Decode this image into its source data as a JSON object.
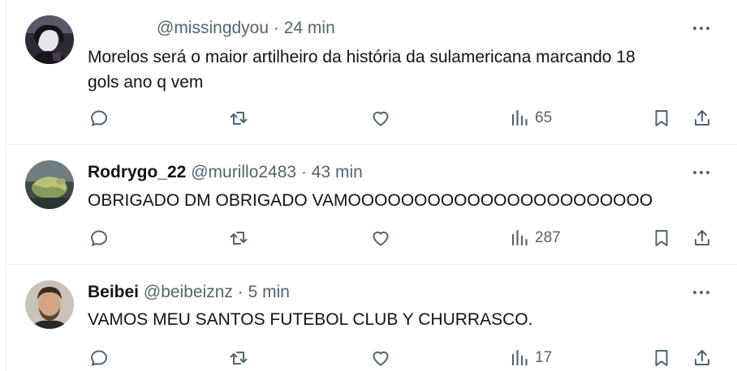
{
  "tweets": [
    {
      "name": "",
      "handle": "@missingdyou",
      "separator": "·",
      "time": "24 min",
      "text_lines": [
        "Morelos será o maior artilheiro da história da sulamericana marcando 18",
        "gols ano q vem"
      ],
      "views": "65"
    },
    {
      "name": "Rodrygo_22",
      "handle": "@murillo2483",
      "separator": "·",
      "time": "43 min",
      "text_lines": [
        "OBRIGADO DM OBRIGADO VAMOOOOOOOOOOOOOOOOOOOOOOO"
      ],
      "views": "287"
    },
    {
      "name": "Beibei",
      "handle": "@beibeiznz",
      "separator": "·",
      "time": "5 min",
      "text_lines": [
        "VAMOS MEU SANTOS FUTEBOL CLUB Y CHURRASCO."
      ],
      "views": "17"
    }
  ],
  "icons": {
    "reply": "reply-icon",
    "retweet": "retweet-icon",
    "like": "heart-icon",
    "views": "views-chart-icon",
    "bookmark": "bookmark-icon",
    "share": "share-icon",
    "more": "more-dots-icon"
  },
  "colors": {
    "secondary_text": "#536471",
    "primary_text": "#0f1419",
    "divider": "#eff3f4"
  }
}
